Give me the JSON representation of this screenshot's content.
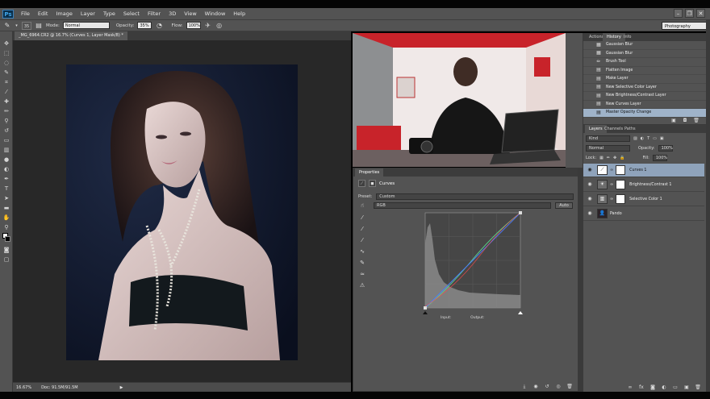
{
  "app": {
    "logo": "Ps"
  },
  "menu": [
    "File",
    "Edit",
    "Image",
    "Layer",
    "Type",
    "Select",
    "Filter",
    "3D",
    "View",
    "Window",
    "Help"
  ],
  "options": {
    "mode_label": "Mode:",
    "mode_value": "Normal",
    "opacity_label": "Opacity:",
    "opacity_value": "35%",
    "flow_label": "Flow:",
    "flow_value": "100%",
    "brush_size": "35",
    "workspace": "Photography"
  },
  "document": {
    "tab_title": "_MG_6964.CR2 @ 16.7% (Curves 1, Layer Mask/8) *",
    "zoom": "16.67%",
    "doc_size": "Doc: 91.5M/91.5M"
  },
  "properties": {
    "tabs": [
      "Properties"
    ],
    "adjustment_name": "Curves",
    "preset_label": "Preset:",
    "preset_value": "Custom",
    "channel_value": "RGB",
    "auto_label": "Auto",
    "input_label": "Input:",
    "output_label": "Output:"
  },
  "history": {
    "tabs": [
      "Actions",
      "History",
      "Info"
    ],
    "items": [
      {
        "label": "Gaussian Blur",
        "icon": "filter-icon"
      },
      {
        "label": "Gaussian Blur",
        "icon": "filter-icon"
      },
      {
        "label": "Brush Tool",
        "icon": "brush-icon"
      },
      {
        "label": "Flatten Image",
        "icon": "layers-icon"
      },
      {
        "label": "Make Layer",
        "icon": "layers-icon"
      },
      {
        "label": "New Selective Color Layer",
        "icon": "layers-icon"
      },
      {
        "label": "New Brightness/Contrast Layer",
        "icon": "layers-icon"
      },
      {
        "label": "New Curves Layer",
        "icon": "layers-icon"
      },
      {
        "label": "Master Opacity Change",
        "icon": "layers-icon",
        "active": true
      }
    ]
  },
  "layers": {
    "tabs": [
      "Layers",
      "Channels",
      "Paths"
    ],
    "kind_label": "Kind",
    "blend_mode": "Normal",
    "opacity_label": "Opacity:",
    "opacity_value": "100%",
    "lock_label": "Lock:",
    "fill_label": "Fill:",
    "fill_value": "100%",
    "items": [
      {
        "name": "Curves 1",
        "type": "curves",
        "selected": true
      },
      {
        "name": "Brightness/Contrast 1",
        "type": "brightness"
      },
      {
        "name": "Selective Color 1",
        "type": "selective"
      },
      {
        "name": "Pando",
        "type": "image"
      }
    ]
  },
  "colors": {
    "panel": "#535353",
    "canvas": "#282828",
    "selection": "#8fa3bb",
    "curve_green": "#5ad28a",
    "curve_blue": "#4a7cff",
    "curve_red": "#ff4a4a"
  }
}
